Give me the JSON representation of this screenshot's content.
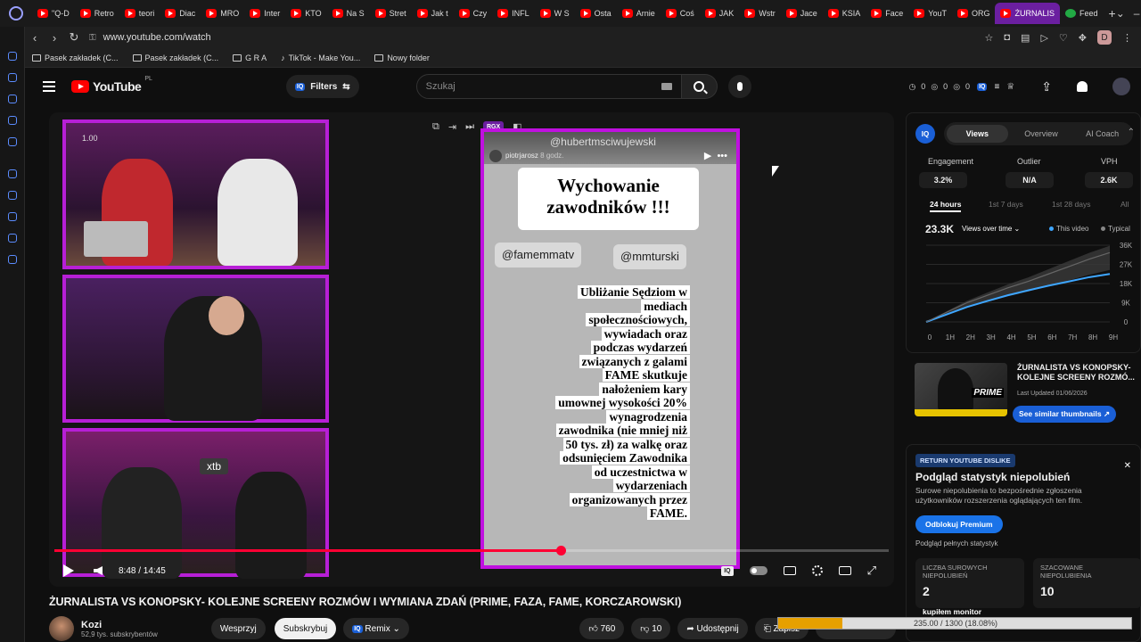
{
  "browser": {
    "tabs": [
      "\"Q-D",
      "Retro",
      "teori",
      "Diac",
      "MRO",
      "Inter",
      "KTO",
      "Na S",
      "Stret",
      "Jak t",
      "Czy",
      "INFL",
      "W S",
      "Osta",
      "Arnie",
      "Coś",
      "JAK",
      "Wstr",
      "Jace",
      "KSIA",
      "Face",
      "YouT",
      "ORG",
      "ŻURNALIS",
      "Feed"
    ],
    "active_tab_index": 23,
    "url": "www.youtube.com/watch",
    "profile_initial": "D",
    "bookmarks": [
      "Pasek zakładek (C...",
      "Pasek zakładek (C...",
      "G R A",
      "TikTok - Make You...",
      "Nowy folder"
    ]
  },
  "yt": {
    "logo_text": "YouTube",
    "country": "PL",
    "filters_label": "Filters",
    "search_placeholder": "Szukaj",
    "counters": [
      "0",
      "0",
      "0"
    ]
  },
  "player": {
    "speed": "1.00",
    "time": "8:48 / 14:45",
    "progress_fraction": 0.6068,
    "overlay_tool": "RGX",
    "phone": {
      "top_watermark": "@hubertmsciwujewski",
      "author": "piotrjarosz",
      "author_time": "8 godz.",
      "title": "Wychowanie zawodników !!!",
      "tag1": "@famemmatv",
      "tag2": "@mmturski",
      "body_lines": [
        "Ubliżanie Sędziom w",
        "mediach",
        "społecznościowych,",
        "wywiadach oraz",
        "podczas wydarzeń",
        "związanych z galami",
        "FAME skutkuje",
        "nałożeniem kary",
        "umownej wysokości 20%",
        "wynagrodzenia",
        "zawodnika (nie mniej niż",
        "50 tys. zł) za walkę oraz",
        "odsunięciem Zawodnika",
        "od uczestnictwa w",
        "wydarzeniach",
        "organizowanych przez",
        "FAME."
      ]
    },
    "cam3_badge": "xtb"
  },
  "video": {
    "title": "ŻURNALISTA VS KONOPSKY- KOLEJNE SCREENY ROZMÓW I WYMIANA ZDAŃ (PRIME, FAZA, FAME, KORCZAROWSKI)",
    "channel": "Kozi",
    "subscribers": "52,9 tys. subskrybentów",
    "support_label": "Wesprzyj",
    "subscribe_label": "Subskrybuj",
    "remix_label": "Remix",
    "likes": "760",
    "dislikes": "10",
    "share_label": "Udostępnij",
    "save_label": "Zapisz"
  },
  "iq_panel": {
    "tabs": [
      "Views",
      "Overview",
      "AI Coach"
    ],
    "metrics": [
      {
        "label": "Engagement",
        "value": "3.2%"
      },
      {
        "label": "Outlier",
        "value": "N/A"
      },
      {
        "label": "VPH",
        "value": "2.6K"
      }
    ],
    "periods": [
      "24 hours",
      "1st 7 days",
      "1st 28 days",
      "All"
    ],
    "big_value": "23.3K",
    "metric_select": "Views over time",
    "legend_this": "This video",
    "legend_typical": "Typical",
    "similar": {
      "title": "ŻURNALISTA VS KONOPSKY- KOLEJNE SCREENY ROZMÓ...",
      "date": "Last Updated 01/06/2026",
      "button": "See similar thumbnails"
    },
    "accent": "#1a5fd6"
  },
  "chart_data": {
    "type": "line",
    "x": [
      "0",
      "1H",
      "2H",
      "3H",
      "4H",
      "5H",
      "6H",
      "7H",
      "8H",
      "9H"
    ],
    "yticks": [
      "36K",
      "27K",
      "18K",
      "9K",
      "0"
    ],
    "ylim": [
      0,
      36000
    ],
    "series": [
      {
        "name": "This video",
        "values": [
          0,
          3500,
          7000,
          9800,
          12500,
          14800,
          17000,
          19000,
          21000,
          22500
        ],
        "color": "#3ea6ff"
      },
      {
        "name": "Typical",
        "values": [
          0,
          4500,
          9000,
          12500,
          16000,
          19000,
          22500,
          26000,
          29500,
          32500
        ],
        "color": "#666666"
      }
    ]
  },
  "dislike_panel": {
    "badge": "RETURN YOUTUBE DISLIKE",
    "title": "Podgląd statystyk niepolubień",
    "desc": "Surowe niepolubienia to bezpośrednie zgłoszenia użytkowników rozszerzenia oglądających ten film.",
    "button": "Odblokuj Premium",
    "sub": "Podgląd pełnych statystyk",
    "box1_label": "LICZBA SUROWYCH NIEPOLUBIEŃ",
    "box1_value": "2",
    "box2_label": "SZACOWANE NIEPOLUBIENIA",
    "box2_value": "10"
  },
  "monitor": {
    "label": "kupiłem monitor",
    "text": "235.00 / 1300 (18.08%)",
    "fraction": 0.1808
  }
}
